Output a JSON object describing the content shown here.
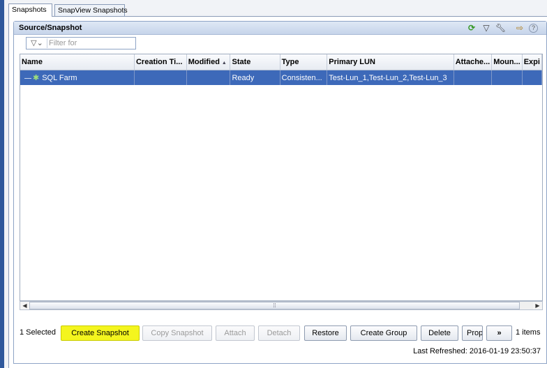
{
  "tabs": [
    "Snapshots",
    "SnapView Snapshots"
  ],
  "panel": {
    "title": "Source/Snapshot",
    "header_icons": [
      "refresh-icon",
      "filter-icon",
      "wrench-icon",
      "export-icon",
      "help-icon"
    ]
  },
  "filter": {
    "placeholder": "Filter for",
    "value": ""
  },
  "table": {
    "columns": [
      "Name",
      "Creation Ti...",
      "Modified",
      "State",
      "Type",
      "Primary LUN",
      "Attache...",
      "Moun...",
      "Expi"
    ],
    "rows": [
      {
        "name": "SQL Farm",
        "creation_time": "",
        "modified": "",
        "state": "Ready",
        "type": "Consisten...",
        "primary_lun": "Test-Lun_1,Test-Lun_2,Test-Lun_3",
        "attached": "",
        "mounted": "",
        "expiration": ""
      }
    ],
    "sorted_column": "Modified",
    "sort_direction": "ascending"
  },
  "footer": {
    "selected_text": "1 Selected",
    "buttons": {
      "create_snapshot": "Create Snapshot",
      "copy_snapshot": "Copy Snapshot",
      "attach": "Attach",
      "detach": "Detach",
      "restore": "Restore",
      "create_group": "Create Group",
      "delete": "Delete",
      "properties": "Properties",
      "more": "»"
    },
    "items_text": "1 items",
    "last_refreshed_label": "Last Refreshed:",
    "last_refreshed_value": "2016-01-19 23:50:37"
  },
  "colors": {
    "selection": "#3d69b9",
    "highlight": "#f4f51e",
    "background": "#3a62a8"
  }
}
